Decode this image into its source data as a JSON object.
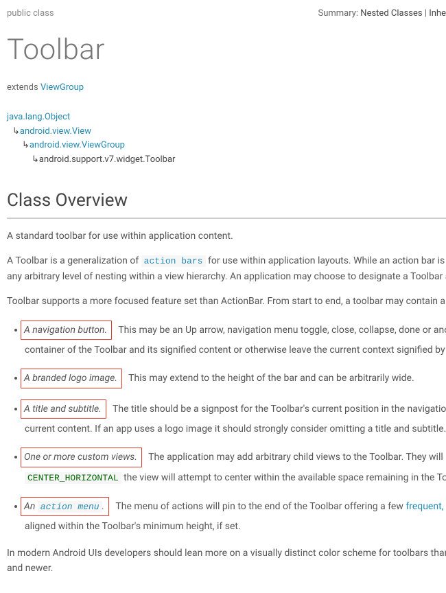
{
  "header": {
    "modifiers": "public class",
    "summary_label": "Summary:",
    "summary_nested": "Nested Classes",
    "summary_sep": " | ",
    "summary_inherited": "Inhe"
  },
  "className": "Toolbar",
  "extends": {
    "label": "extends ",
    "link": "ViewGroup"
  },
  "hierarchy": {
    "l0": "java.lang.Object",
    "l1": "android.view.View",
    "l2": "android.view.ViewGroup",
    "l3": "android.support.v7.widget.Toolbar"
  },
  "overview": {
    "heading": "Class Overview",
    "p1": "A standard toolbar for use within application content.",
    "p2a": "A Toolbar is a generalization of ",
    "p2code": "action bars",
    "p2b": " for use within application layouts. While an action bar is traditiona",
    "p2c": "any arbitrary level of nesting within a view hierarchy. An application may choose to designate a Toolbar as the ac",
    "p3": "Toolbar supports a more focused feature set than ActionBar. From start to end, a toolbar may contain a combina"
  },
  "features": {
    "nav": {
      "lead": "A navigation button.",
      "rest": " This may be an Up arrow, navigation menu toggle, close, collapse, done or another glyph o",
      "cont": "container of the Toolbar and its signified content or otherwise leave the current context signified by the Toolb"
    },
    "logo": {
      "lead": "A branded logo image.",
      "rest": " This may extend to the height of the bar and can be arbitrarily wide."
    },
    "title": {
      "lead": "A title and subtitle.",
      "rest": " The title should be a signpost for the Toolbar's current position in the navigation hierarchy ",
      "cont": "current content. If an app uses a logo image it should strongly consider omitting a title and subtitle."
    },
    "custom": {
      "lead": "One or more custom views.",
      "rest": " The application may add arbitrary child views to the Toolbar. They will appear at th",
      "code": "CENTER_HORIZONTAL",
      "cont2": " the view will attempt to center within the available space remaining in the Toolbar after a"
    },
    "menu": {
      "lead_a": "An ",
      "lead_code": "action menu",
      "lead_b": ".",
      "rest_a": " The menu of actions will pin to the end of the Toolbar offering a few ",
      "rest_link": "frequent, important or t",
      "cont": "aligned within the Toolbar's minimum height, if set."
    }
  },
  "closing": {
    "p1": "In modern Android UIs developers should lean more on a visually distinct color scheme for toolbars than on their",
    "p2": "and newer."
  }
}
